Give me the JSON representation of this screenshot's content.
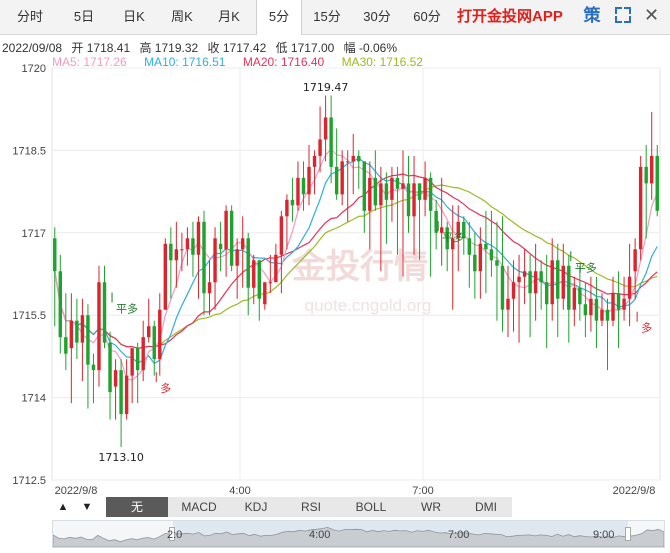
{
  "tabs": [
    {
      "label": "分时",
      "x": 6,
      "w": 48
    },
    {
      "label": "5日",
      "x": 62,
      "w": 44
    },
    {
      "label": "日K",
      "x": 112,
      "w": 44
    },
    {
      "label": "周K",
      "x": 160,
      "w": 44
    },
    {
      "label": "月K",
      "x": 207,
      "w": 44
    },
    {
      "label": "5分",
      "x": 256,
      "w": 44,
      "active": true
    },
    {
      "label": "15分",
      "x": 304,
      "w": 46
    },
    {
      "label": "30分",
      "x": 354,
      "w": 46
    },
    {
      "label": "60分",
      "x": 404,
      "w": 46
    }
  ],
  "promo": "打开金投网APP",
  "icons": {
    "ce": "策"
  },
  "info": {
    "date": "2022/09/08",
    "open": "开 1718.41",
    "high": "高 1719.32",
    "close": "收 1717.42",
    "low": "低 1717.00",
    "change": "幅 -0.06%"
  },
  "ma": {
    "ma5": {
      "label": "MA5: 1717.26",
      "color": "#f49ac1"
    },
    "ma10": {
      "label": "MA10: 1716.51",
      "color": "#2fb0d8"
    },
    "ma20": {
      "label": "MA20: 1716.40",
      "color": "#e4325c"
    },
    "ma30": {
      "label": "MA30: 1716.52",
      "color": "#9cba23"
    }
  },
  "watermark": {
    "main": "金投行情",
    "sub": "quote.cngold.org"
  },
  "toolbar": {
    "items": [
      "无",
      "MACD",
      "KDJ",
      "RSI",
      "BOLL",
      "WR",
      "DMI"
    ],
    "active": 0
  },
  "navigator": {
    "labels": [
      "2:0",
      "4:00",
      "7:00",
      "9:00"
    ]
  },
  "chart_data": {
    "type": "candlestick",
    "ylim": [
      1712.5,
      1720
    ],
    "yticks": [
      "1720",
      "1718.5",
      "1717",
      "1715.5",
      "1714",
      "1712.5"
    ],
    "x_labels": [
      "2022/9/8",
      "4:00",
      "7:00",
      "2022/9/8"
    ],
    "up_color": "#d9262e",
    "down_color": "#1fa22e",
    "annotations": [
      {
        "text": "1719.47",
        "candle": 49,
        "value": 1719.47,
        "where": "above"
      },
      {
        "text": "1713.10",
        "candle": 12,
        "value": 1713.1,
        "where": "below"
      },
      {
        "text": "平多",
        "candle": 10,
        "value": 1715.55
      },
      {
        "text": "多",
        "candle": 18,
        "value": 1714.1
      },
      {
        "text": "平多",
        "candle": 69,
        "value": 1716.85
      },
      {
        "text": "平多",
        "candle": 93,
        "value": 1716.3
      },
      {
        "text": "多",
        "candle": 105,
        "value": 1715.2
      }
    ],
    "candles": [
      [
        1716.9,
        1717.1,
        1715.3,
        1716.3
      ],
      [
        1716.3,
        1716.6,
        1714.8,
        1715.1
      ],
      [
        1715.1,
        1715.9,
        1714.5,
        1714.8
      ],
      [
        1714.9,
        1715.9,
        1713.9,
        1715.4
      ],
      [
        1715.4,
        1715.8,
        1714.7,
        1715.0
      ],
      [
        1715.0,
        1715.8,
        1714.3,
        1715.5
      ],
      [
        1715.5,
        1715.7,
        1713.8,
        1714.6
      ],
      [
        1714.6,
        1714.8,
        1713.9,
        1714.5
      ],
      [
        1714.5,
        1716.4,
        1714.2,
        1716.1
      ],
      [
        1716.1,
        1716.4,
        1714.9,
        1715.0
      ],
      [
        1715.0,
        1715.2,
        1713.6,
        1714.1
      ],
      [
        1714.2,
        1714.7,
        1713.6,
        1714.5
      ],
      [
        1714.5,
        1714.7,
        1713.1,
        1713.7
      ],
      [
        1713.7,
        1714.7,
        1713.6,
        1714.4
      ],
      [
        1714.4,
        1714.9,
        1713.9,
        1714.9
      ],
      [
        1714.9,
        1715.0,
        1713.9,
        1714.5
      ],
      [
        1714.5,
        1715.4,
        1714.3,
        1715.1
      ],
      [
        1715.1,
        1715.8,
        1715.0,
        1715.3
      ],
      [
        1715.3,
        1715.4,
        1714.4,
        1714.7
      ],
      [
        1714.7,
        1715.9,
        1714.4,
        1715.6
      ],
      [
        1715.6,
        1716.9,
        1715.6,
        1716.8
      ],
      [
        1716.8,
        1717.1,
        1715.8,
        1716.5
      ],
      [
        1716.5,
        1717.2,
        1716.0,
        1716.7
      ],
      [
        1716.7,
        1717.0,
        1716.3,
        1716.7
      ],
      [
        1716.7,
        1717.1,
        1716.4,
        1716.9
      ],
      [
        1716.9,
        1717.2,
        1716.2,
        1716.6
      ],
      [
        1716.6,
        1717.3,
        1715.8,
        1717.2
      ],
      [
        1717.2,
        1717.4,
        1715.5,
        1715.9
      ],
      [
        1715.9,
        1716.5,
        1715.5,
        1716.1
      ],
      [
        1716.1,
        1717.1,
        1715.6,
        1716.9
      ],
      [
        1716.8,
        1717.2,
        1716.3,
        1716.7
      ],
      [
        1716.7,
        1717.5,
        1716.2,
        1717.4
      ],
      [
        1717.4,
        1717.5,
        1716.3,
        1716.4
      ],
      [
        1716.4,
        1716.9,
        1715.8,
        1716.7
      ],
      [
        1716.7,
        1717.3,
        1716.0,
        1716.9
      ],
      [
        1716.9,
        1717.0,
        1715.5,
        1716.0
      ],
      [
        1716.0,
        1716.6,
        1715.7,
        1716.5
      ],
      [
        1716.5,
        1716.5,
        1715.4,
        1715.8
      ],
      [
        1715.7,
        1716.1,
        1715.6,
        1716.1
      ],
      [
        1716.1,
        1716.6,
        1715.9,
        1716.1
      ],
      [
        1716.1,
        1716.8,
        1716.1,
        1716.6
      ],
      [
        1716.6,
        1717.4,
        1715.9,
        1717.3
      ],
      [
        1717.3,
        1717.7,
        1716.7,
        1717.6
      ],
      [
        1717.6,
        1718.0,
        1717.2,
        1717.5
      ],
      [
        1717.5,
        1718.3,
        1717.4,
        1718.0
      ],
      [
        1718.0,
        1718.3,
        1717.4,
        1717.7
      ],
      [
        1717.7,
        1718.6,
        1717.5,
        1718.2
      ],
      [
        1718.2,
        1718.5,
        1717.7,
        1718.4
      ],
      [
        1718.4,
        1719.3,
        1718.1,
        1718.7
      ],
      [
        1718.7,
        1719.5,
        1718.3,
        1719.1
      ],
      [
        1719.1,
        1719.5,
        1717.9,
        1718.2
      ],
      [
        1718.2,
        1718.9,
        1717.6,
        1717.7
      ],
      [
        1717.7,
        1718.5,
        1717.5,
        1718.3
      ],
      [
        1718.3,
        1718.5,
        1717.2,
        1718.3
      ],
      [
        1718.3,
        1718.8,
        1717.7,
        1718.4
      ],
      [
        1718.4,
        1718.5,
        1717.8,
        1718.3
      ],
      [
        1718.3,
        1718.3,
        1717.0,
        1717.4
      ],
      [
        1717.4,
        1718.3,
        1716.7,
        1718.0
      ],
      [
        1718.0,
        1718.5,
        1717.4,
        1717.5
      ],
      [
        1717.5,
        1718.2,
        1716.3,
        1717.9
      ],
      [
        1717.9,
        1718.1,
        1716.8,
        1717.6
      ],
      [
        1717.6,
        1718.2,
        1717.2,
        1718.0
      ],
      [
        1718.0,
        1718.2,
        1716.6,
        1717.8
      ],
      [
        1717.8,
        1718.5,
        1716.2,
        1717.9
      ],
      [
        1717.9,
        1718.4,
        1717.0,
        1717.3
      ],
      [
        1717.3,
        1718.4,
        1716.6,
        1717.9
      ],
      [
        1717.9,
        1717.9,
        1716.5,
        1717.6
      ],
      [
        1717.6,
        1718.3,
        1717.3,
        1718.0
      ],
      [
        1718.0,
        1718.1,
        1716.2,
        1717.4
      ],
      [
        1717.4,
        1717.6,
        1716.7,
        1717.0
      ],
      [
        1717.0,
        1718.0,
        1716.4,
        1717.1
      ],
      [
        1717.1,
        1717.2,
        1716.3,
        1716.7
      ],
      [
        1716.7,
        1717.5,
        1715.6,
        1716.9
      ],
      [
        1716.9,
        1717.5,
        1716.3,
        1717.2
      ],
      [
        1717.2,
        1717.3,
        1716.6,
        1716.9
      ],
      [
        1716.9,
        1717.2,
        1716.0,
        1716.6
      ],
      [
        1716.6,
        1717.0,
        1715.8,
        1716.3
      ],
      [
        1716.3,
        1717.1,
        1715.8,
        1716.8
      ],
      [
        1716.8,
        1717.4,
        1715.9,
        1716.7
      ],
      [
        1716.7,
        1717.4,
        1716.2,
        1716.5
      ],
      [
        1716.5,
        1717.2,
        1715.4,
        1716.4
      ],
      [
        1716.4,
        1717.3,
        1715.2,
        1715.6
      ],
      [
        1715.6,
        1716.4,
        1715.1,
        1715.8
      ],
      [
        1715.8,
        1716.5,
        1715.2,
        1716.1
      ],
      [
        1716.1,
        1716.6,
        1715.0,
        1716.2
      ],
      [
        1716.2,
        1716.7,
        1715.7,
        1716.3
      ],
      [
        1716.3,
        1716.6,
        1715.1,
        1715.9
      ],
      [
        1715.9,
        1716.8,
        1715.4,
        1716.3
      ],
      [
        1716.3,
        1716.5,
        1715.6,
        1716.1
      ],
      [
        1716.1,
        1716.6,
        1714.9,
        1715.7
      ],
      [
        1715.7,
        1716.9,
        1715.4,
        1716.5
      ],
      [
        1716.5,
        1716.8,
        1715.1,
        1715.8
      ],
      [
        1715.8,
        1716.8,
        1715.6,
        1716.4
      ],
      [
        1716.4,
        1716.6,
        1715.0,
        1715.6
      ],
      [
        1715.6,
        1716.2,
        1715.3,
        1716.0
      ],
      [
        1716.0,
        1716.4,
        1715.4,
        1715.7
      ],
      [
        1715.7,
        1716.1,
        1715.1,
        1715.5
      ],
      [
        1715.5,
        1716.2,
        1715.2,
        1715.8
      ],
      [
        1715.8,
        1716.2,
        1714.9,
        1715.4
      ],
      [
        1715.4,
        1715.9,
        1715.3,
        1715.6
      ],
      [
        1715.6,
        1715.8,
        1714.5,
        1715.4
      ],
      [
        1715.4,
        1716.2,
        1715.3,
        1715.9
      ],
      [
        1715.9,
        1716.3,
        1714.9,
        1715.6
      ],
      [
        1715.6,
        1716.2,
        1715.4,
        1715.8
      ],
      [
        1715.8,
        1716.8,
        1715.3,
        1716.2
      ],
      [
        1716.3,
        1716.9,
        1715.8,
        1716.7
      ],
      [
        1716.7,
        1718.4,
        1716.5,
        1718.2
      ],
      [
        1718.2,
        1718.6,
        1716.9,
        1717.9
      ],
      [
        1717.9,
        1719.2,
        1717.6,
        1718.4
      ],
      [
        1718.4,
        1718.6,
        1717.3,
        1717.4
      ]
    ]
  }
}
